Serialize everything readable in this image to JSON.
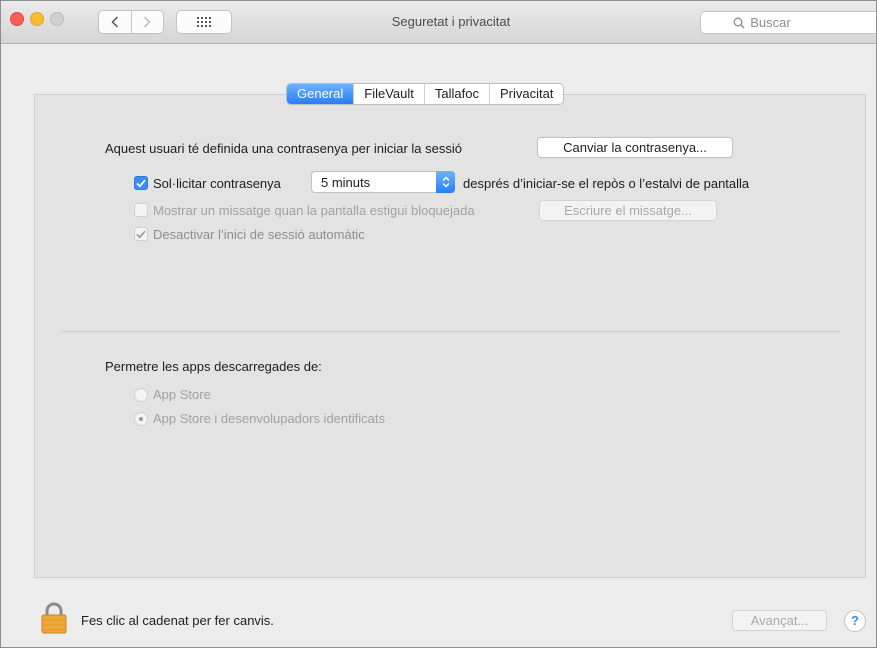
{
  "window": {
    "title": "Seguretat i privacitat",
    "search_placeholder": "Buscar"
  },
  "tabs": [
    {
      "label": "General",
      "active": true
    },
    {
      "label": "FileVault",
      "active": false
    },
    {
      "label": "Tallafoc",
      "active": false
    },
    {
      "label": "Privacitat",
      "active": false
    }
  ],
  "general": {
    "password_text": "Aquest usuari té definida una contrasenya per iniciar la sessió",
    "change_password_button": "Canviar la contrasenya...",
    "require_password": {
      "label": "Sol·licitar contrasenya",
      "checked": true,
      "delay_value": "5 minuts",
      "after_text": "després d’iniciar-se el repòs o l’estalvi de pantalla"
    },
    "show_message": {
      "label": "Mostrar un missatge quan la pantalla estigui bloquejada",
      "checked": false,
      "button": "Escriure el missatge..."
    },
    "disable_autologin": {
      "label": "Desactivar l’inici de sessió automàtic",
      "checked": true
    }
  },
  "apps": {
    "heading": "Permetre les apps descarregades de:",
    "options": [
      {
        "label": "App Store",
        "selected": false
      },
      {
        "label": "App Store i desenvolupadors identificats",
        "selected": true
      }
    ]
  },
  "footer": {
    "lock_text": "Fes clic al cadenat per fer canvis.",
    "advanced_button": "Avançat...",
    "help_label": "?"
  },
  "colors": {
    "accent": "#3a8cf6",
    "close": "#fc5f57",
    "minimize": "#fdbc2e"
  },
  "icons": [
    "back-chevron-icon",
    "forward-chevron-icon",
    "grid-icon",
    "search-icon",
    "lock-icon",
    "help-icon"
  ]
}
